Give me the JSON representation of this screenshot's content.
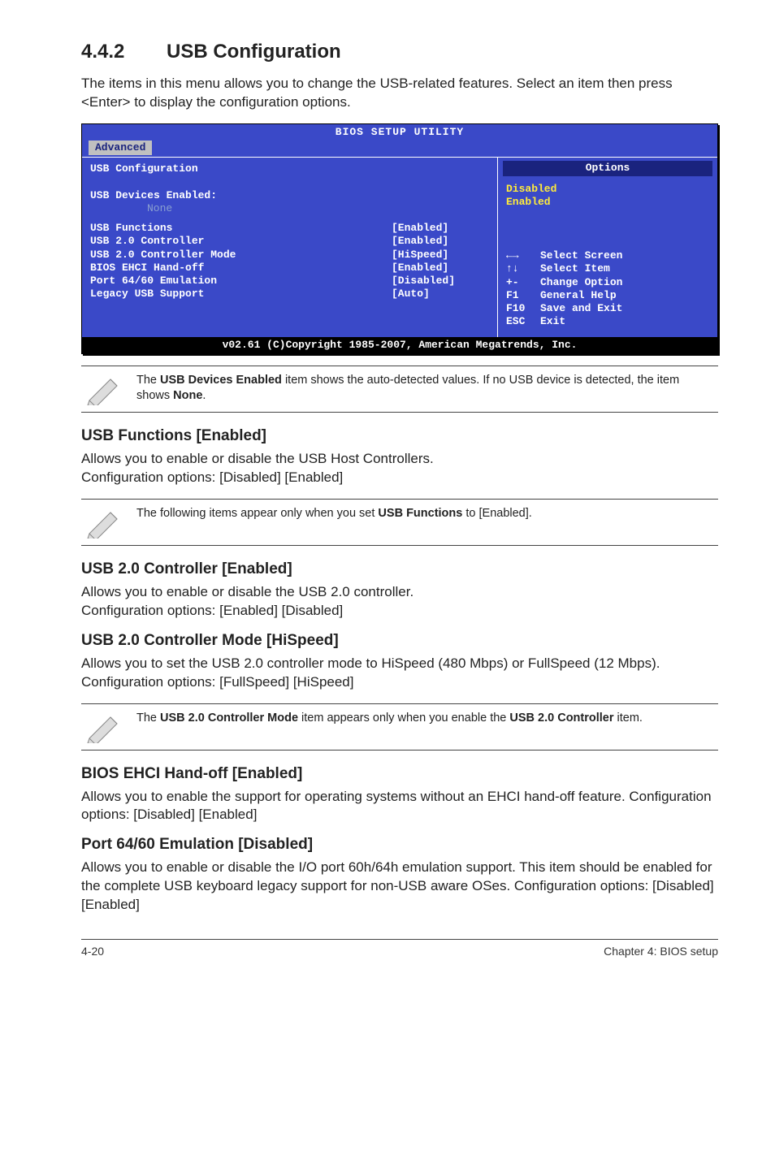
{
  "heading": {
    "number": "4.4.2",
    "title": "USB Configuration"
  },
  "intro": "The items in this menu allows you to change the USB-related features. Select an item then press <Enter> to display the configuration options.",
  "bios": {
    "title": "BIOS SETUP UTILITY",
    "tab": "Advanced",
    "panel_title": "USB Configuration",
    "devices_label": "USB Devices Enabled:",
    "devices_value": "None",
    "rows": [
      {
        "k": "USB Functions",
        "v": "[Enabled]"
      },
      {
        "k": "USB 2.0 Controller",
        "v": "[Enabled]"
      },
      {
        "k": "USB 2.0 Controller Mode",
        "v": "[HiSpeed]"
      },
      {
        "k": "BIOS EHCI Hand-off",
        "v": "[Enabled]"
      },
      {
        "k": "Port 64/60 Emulation",
        "v": "[Disabled]"
      },
      {
        "k": "Legacy USB Support",
        "v": "[Auto]"
      }
    ],
    "options_label": "Options",
    "options_values": [
      "Disabled",
      "Enabled"
    ],
    "nav": [
      {
        "sym": "←→",
        "txt": "Select Screen"
      },
      {
        "sym": "↑↓",
        "txt": "Select Item"
      },
      {
        "sym": "+-",
        "txt": "Change Option"
      },
      {
        "sym": "F1",
        "txt": "General Help"
      },
      {
        "sym": "F10",
        "txt": "Save and Exit"
      },
      {
        "sym": "ESC",
        "txt": "Exit"
      }
    ],
    "footer": "v02.61 (C)Copyright 1985-2007, American Megatrends, Inc."
  },
  "note1_a": "The ",
  "note1_b": "USB Devices Enabled",
  "note1_c": " item shows the auto-detected values. If no USB device is detected, the item shows ",
  "note1_d": "None",
  "note1_e": ".",
  "s1": {
    "h": "USB Functions [Enabled]",
    "p1": "Allows you to enable or disable the USB Host Controllers.",
    "p2": "Configuration options: [Disabled] [Enabled]"
  },
  "note2_a": "The following items appear only when you set ",
  "note2_b": "USB Functions",
  "note2_c": " to [Enabled].",
  "s2": {
    "h": "USB 2.0 Controller [Enabled]",
    "p1": "Allows you to enable or disable the USB 2.0 controller.",
    "p2": "Configuration options: [Enabled] [Disabled]"
  },
  "s3": {
    "h": "USB 2.0 Controller Mode [HiSpeed]",
    "p": "Allows you to set the USB 2.0 controller mode to HiSpeed (480 Mbps) or FullSpeed (12 Mbps). Configuration options: [FullSpeed] [HiSpeed]"
  },
  "note3_a": "The ",
  "note3_b": "USB 2.0 Controller Mode",
  "note3_c": " item appears only when you enable the ",
  "note3_d": "USB 2.0 Controller",
  "note3_e": " item.",
  "s4": {
    "h": "BIOS EHCI Hand-off [Enabled]",
    "p": "Allows you to enable the support for operating systems without an EHCI hand-off feature. Configuration options: [Disabled] [Enabled]"
  },
  "s5": {
    "h": "Port 64/60 Emulation [Disabled]",
    "p": "Allows you to enable or disable the I/O port 60h/64h emulation support. This item should be enabled for the complete USB keyboard legacy support for non-USB aware OSes. Configuration options: [Disabled] [Enabled]"
  },
  "footer": {
    "left": "4-20",
    "right": "Chapter 4: BIOS setup"
  }
}
